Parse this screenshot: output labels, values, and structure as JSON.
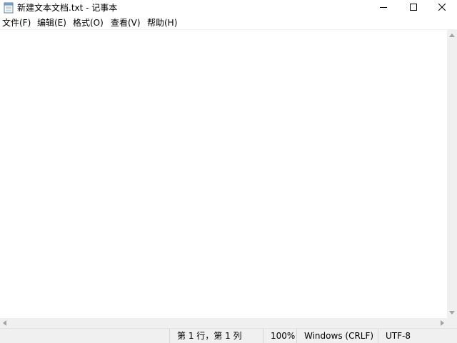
{
  "window": {
    "title": "新建文本文档.txt - 记事本",
    "icon": "notepad-icon",
    "controls": [
      "minimize-icon",
      "maximize-icon",
      "close-icon"
    ]
  },
  "menu": {
    "file": "文件(F)",
    "edit": "编辑(E)",
    "format": "格式(O)",
    "view": "查看(V)",
    "help": "帮助(H)"
  },
  "editor": {
    "content": ""
  },
  "status": {
    "position": "第 1 行，第 1 列",
    "zoom": "100%",
    "line_ending": "Windows (CRLF)",
    "encoding": "UTF-8"
  }
}
